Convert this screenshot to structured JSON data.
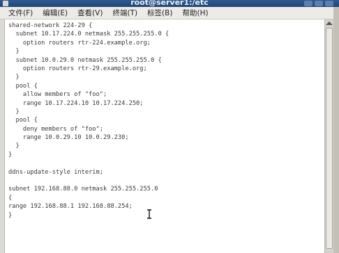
{
  "window": {
    "title": "root@server1:/etc",
    "accent": "#2a4f82"
  },
  "menubar": {
    "items": [
      "文件(F)",
      "编辑(E)",
      "查看(V)",
      "终端(T)",
      "标签(B)",
      "帮助(H)"
    ]
  },
  "editor": {
    "lines": [
      "shared-network 224-29 {",
      "  subnet 10.17.224.0 netmask 255.255.255.0 {",
      "    option routers rtr-224.example.org;",
      "  }",
      "  subnet 10.0.29.0 netmask 255.255.255.0 {",
      "    option routers rtr-29.example.org;",
      "  }",
      "  pool {",
      "    allow members of \"foo\";",
      "    range 10.17.224.10 10.17.224.250;",
      "  }",
      "  pool {",
      "    deny members of \"foo\";",
      "    range 10.0.29.10 10.0.29.230;",
      "  }",
      "}",
      "",
      "ddns-update-style interim;",
      "",
      "subnet 192.168.88.0 netmask 255.255.255.0",
      "{",
      "range 192.168.88.1 192.168.88.254;",
      "}"
    ],
    "cursor_icon": "i-beam-cursor-icon"
  }
}
